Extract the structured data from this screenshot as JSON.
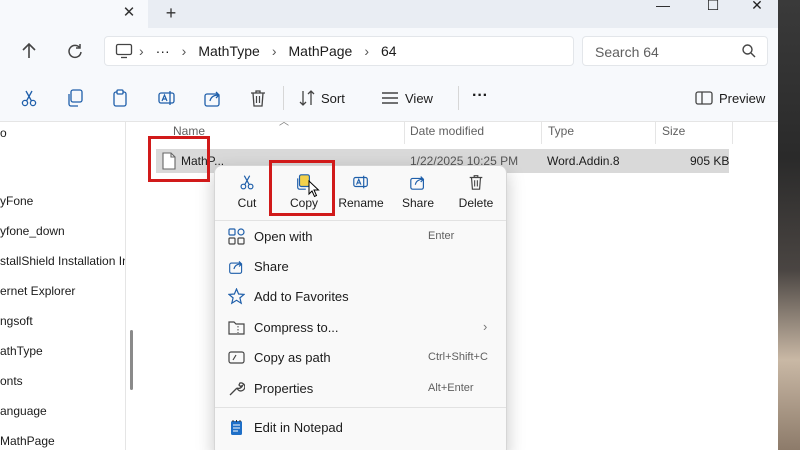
{
  "colors": {
    "accent": "#0067c0",
    "highlight_box": "#d11a1a",
    "selected_row": "#d9d9d9",
    "menu_bg": "#f9f9f9"
  },
  "tabbar": {
    "close_glyph": "✕",
    "new_tab_glyph": "+"
  },
  "window_controls": {
    "minimize": "—",
    "maximize": "☐",
    "close": "✕"
  },
  "address": {
    "segments": [
      "MathType",
      "MathPage",
      "64"
    ],
    "ellipsis": "···"
  },
  "search": {
    "placeholder": "Search 64"
  },
  "commandbar": {
    "sort_label": "Sort",
    "view_label": "View",
    "more_label": "···",
    "preview_label": "Preview"
  },
  "sidebar": {
    "items": [
      "o",
      "yFone",
      "yfone_down",
      "stallShield Installation Info",
      "ernet Explorer",
      "ngsoft",
      "athType",
      "onts",
      "anguage",
      "MathPage"
    ]
  },
  "columns": {
    "name": "Name",
    "date": "Date modified",
    "type": "Type",
    "size": "Size"
  },
  "file": {
    "name": "MathP...",
    "date": "1/22/2025 10:25 PM",
    "type": "Word.Addin.8",
    "size": "905 KB"
  },
  "context_menu": {
    "top_actions": [
      {
        "label": "Cut",
        "icon": "scissors-icon"
      },
      {
        "label": "Copy",
        "icon": "copy-icon"
      },
      {
        "label": "Rename",
        "icon": "rename-icon"
      },
      {
        "label": "Share",
        "icon": "share-icon"
      },
      {
        "label": "Delete",
        "icon": "trash-icon"
      }
    ],
    "items": [
      {
        "label": "Open with",
        "shortcut": "Enter",
        "icon": "open-with-icon"
      },
      {
        "label": "Share",
        "shortcut": "",
        "icon": "share-icon"
      },
      {
        "label": "Add to Favorites",
        "shortcut": "",
        "icon": "star-icon"
      },
      {
        "label": "Compress to...",
        "shortcut": "",
        "icon": "zip-folder-icon"
      },
      {
        "label": "Copy as path",
        "shortcut": "Ctrl+Shift+C",
        "icon": "copy-path-icon"
      },
      {
        "label": "Properties",
        "shortcut": "Alt+Enter",
        "icon": "wrench-icon"
      },
      {
        "label": "Edit in Notepad",
        "shortcut": "",
        "icon": "notepad-icon"
      }
    ]
  }
}
